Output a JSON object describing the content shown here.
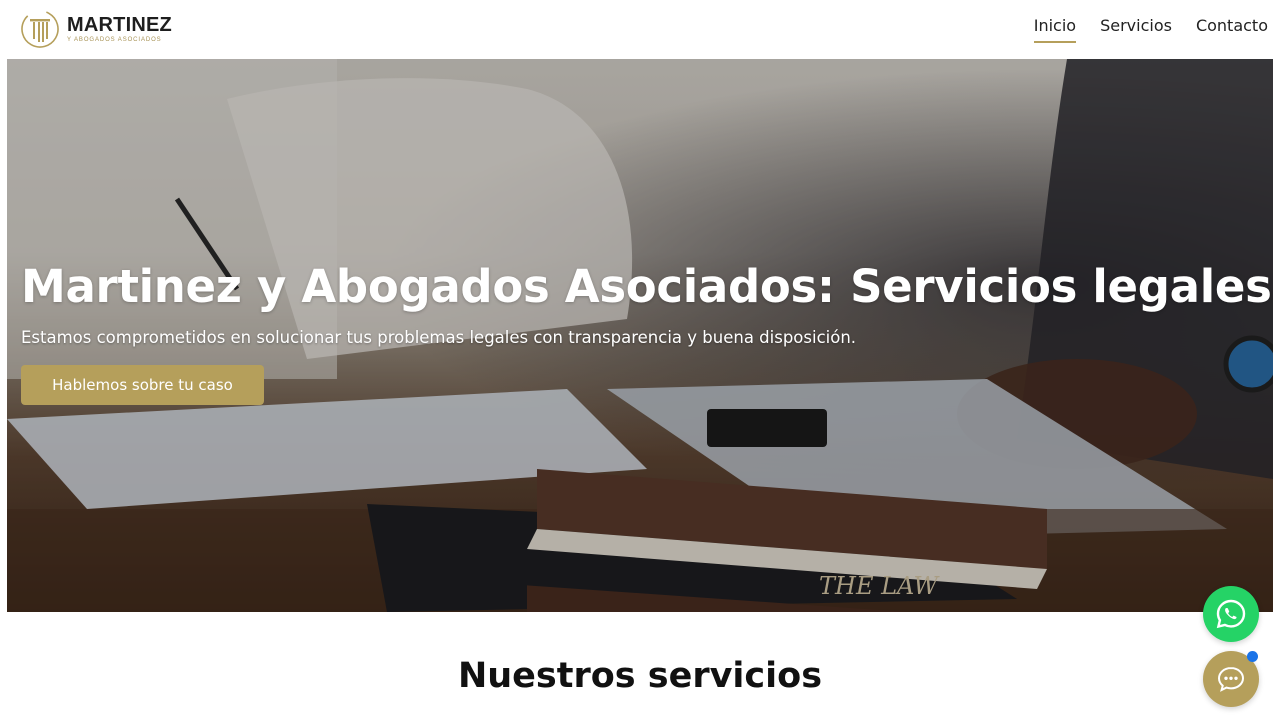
{
  "brand": {
    "name": "MARTINEZ",
    "tagline": "Y ABOGADOS ASOCIADOS",
    "accent_color": "#b59f5b"
  },
  "nav": {
    "items": [
      {
        "label": "Inicio",
        "active": true
      },
      {
        "label": "Servicios",
        "active": false
      },
      {
        "label": "Contacto",
        "active": false
      }
    ]
  },
  "hero": {
    "title": "Martinez y Abogados Asociados: Servicios legales",
    "subtitle": "Estamos comprometidos en solucionar tus problemas legales con transparencia y buena disposición.",
    "cta_label": "Hablemos sobre tu caso",
    "book_spine_text": "THE LAW"
  },
  "services": {
    "heading": "Nuestros servicios"
  },
  "floating": {
    "whatsapp_icon": "whatsapp-icon",
    "chat_icon": "chat-bubble-icon",
    "whatsapp_color": "#25d366",
    "notification_color": "#1a73e8"
  }
}
